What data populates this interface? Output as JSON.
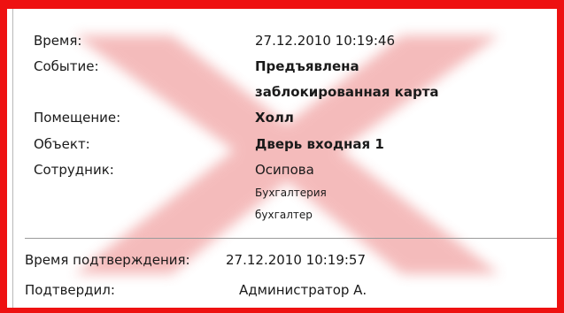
{
  "event": {
    "time_label": "Время:",
    "time_value": "27.12.2010 10:19:46",
    "event_label": "Событие:",
    "event_value_line1": "Предъявлена",
    "event_value_line2": "заблокированная карта",
    "room_label": "Помещение:",
    "room_value": "Холл",
    "object_label": "Объект:",
    "object_value": "Дверь входная 1",
    "employee_label": "Сотрудник:",
    "employee_name": "Осипова",
    "employee_department": "Бухгалтерия",
    "employee_position": "бухгалтер"
  },
  "confirmation": {
    "time_label": "Время подтверждения:",
    "time_value": "27.12.2010 10:19:57",
    "by_label": "Подтвердил:",
    "by_value": "Администратор А."
  },
  "colors": {
    "alarm_border": "#ee1111",
    "watermark": "#e86a6a"
  },
  "watermark_icon": "blurred-cross-mark"
}
